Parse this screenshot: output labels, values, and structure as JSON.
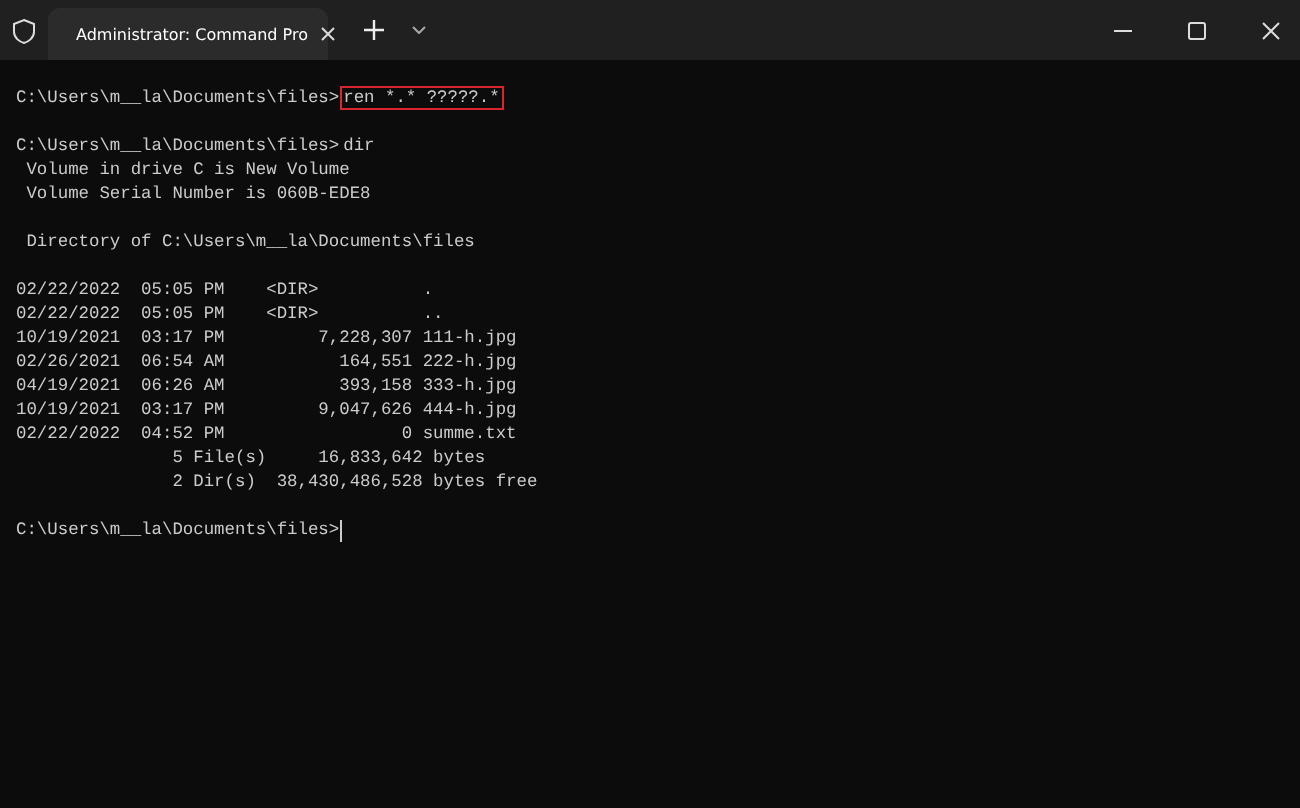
{
  "tab": {
    "title": "Administrator: Command Pro"
  },
  "blocks": [
    [
      {
        "kind": "command",
        "prompt": "C:\\Users\\m__la\\Documents\\files>",
        "command": "ren *.* ?????.*",
        "highlighted": true
      }
    ],
    [
      {
        "kind": "command",
        "prompt": "C:\\Users\\m__la\\Documents\\files>",
        "command": "dir"
      },
      {
        "kind": "text",
        "text": " Volume in drive C is New Volume"
      },
      {
        "kind": "text",
        "text": " Volume Serial Number is 060B-EDE8"
      }
    ],
    [
      {
        "kind": "text",
        "text": " Directory of C:\\Users\\m__la\\Documents\\files"
      }
    ],
    [
      {
        "kind": "text",
        "text": "02/22/2022  05:05 PM    <DIR>          ."
      },
      {
        "kind": "text",
        "text": "02/22/2022  05:05 PM    <DIR>          .."
      },
      {
        "kind": "text",
        "text": "10/19/2021  03:17 PM         7,228,307 111-h.jpg"
      },
      {
        "kind": "text",
        "text": "02/26/2021  06:54 AM           164,551 222-h.jpg"
      },
      {
        "kind": "text",
        "text": "04/19/2021  06:26 AM           393,158 333-h.jpg"
      },
      {
        "kind": "text",
        "text": "10/19/2021  03:17 PM         9,047,626 444-h.jpg"
      },
      {
        "kind": "text",
        "text": "02/22/2022  04:52 PM                 0 summe.txt"
      },
      {
        "kind": "text",
        "text": "               5 File(s)     16,833,642 bytes"
      },
      {
        "kind": "text",
        "text": "               2 Dir(s)  38,430,486,528 bytes free"
      }
    ],
    [
      {
        "kind": "command",
        "prompt": "C:\\Users\\m__la\\Documents\\files>",
        "cursor": true
      }
    ]
  ]
}
